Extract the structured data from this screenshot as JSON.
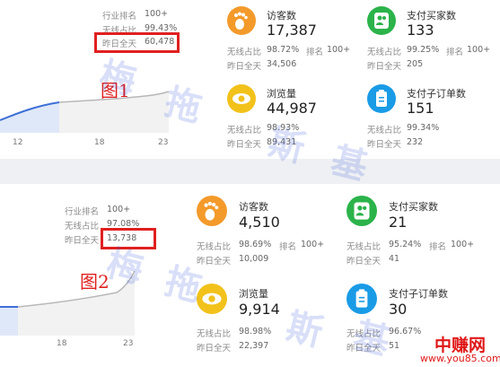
{
  "panel1": {
    "left_stats": {
      "industry_rank_label": "行业排名",
      "industry_rank_value": "100+",
      "wireless_label": "无线占比",
      "wireless_value": "99.43%",
      "yesterday_label": "昨日全天",
      "yesterday_value": "60,478"
    },
    "figure_label": "图1",
    "x_ticks": [
      "12",
      "18",
      "23"
    ],
    "cards": {
      "visitors": {
        "title": "访客数",
        "value": "17,387",
        "wireless_label": "无线占比",
        "wireless_value": "98.72%",
        "rank_label": "排名",
        "rank_value": "100+",
        "yesterday_label": "昨日全天",
        "yesterday_value": "34,506"
      },
      "buyers": {
        "title": "支付买家数",
        "value": "133",
        "wireless_label": "无线占比",
        "wireless_value": "99.25%",
        "rank_label": "排名",
        "rank_value": "100+",
        "yesterday_label": "昨日全天",
        "yesterday_value": "205"
      },
      "pageviews": {
        "title": "浏览量",
        "value": "44,987",
        "wireless_label": "无线占比",
        "wireless_value": "98.93%",
        "yesterday_label": "昨日全天",
        "yesterday_value": "89,431"
      },
      "orders": {
        "title": "支付子订单数",
        "value": "151",
        "wireless_label": "无线占比",
        "wireless_value": "99.34%",
        "yesterday_label": "昨日全天",
        "yesterday_value": "232"
      }
    }
  },
  "panel2": {
    "left_stats": {
      "industry_rank_label": "行业排名",
      "industry_rank_value": "100+",
      "wireless_label": "无线占比",
      "wireless_value": "97.08%",
      "yesterday_label": "昨日全天",
      "yesterday_value": "13,738"
    },
    "figure_label": "图2",
    "x_ticks": [
      "18",
      "23"
    ],
    "cards": {
      "visitors": {
        "title": "访客数",
        "value": "4,510",
        "wireless_label": "无线占比",
        "wireless_value": "98.69%",
        "rank_label": "排名",
        "rank_value": "100+",
        "yesterday_label": "昨日全天",
        "yesterday_value": "10,009"
      },
      "buyers": {
        "title": "支付买家数",
        "value": "21",
        "wireless_label": "无线占比",
        "wireless_value": "95.24%",
        "rank_label": "排名",
        "rank_value": "100+",
        "yesterday_label": "昨日全天",
        "yesterday_value": "41"
      },
      "pageviews": {
        "title": "浏览量",
        "value": "9,914",
        "wireless_label": "无线占比",
        "wireless_value": "98.98%",
        "yesterday_label": "昨日全天",
        "yesterday_value": "22,397"
      },
      "orders": {
        "title": "支付子订单数",
        "value": "30",
        "wireless_label": "无线占比",
        "wireless_value": "96.67%",
        "yesterday_label": "昨日全天",
        "yesterday_value": "51"
      }
    }
  },
  "watermark": {
    "chars": [
      "梅",
      "拖",
      "斯",
      "基"
    ]
  },
  "logo": {
    "main": "中赚网",
    "url": "www.you85.com"
  },
  "colors": {
    "orange": "#f39a2b",
    "green": "#2bb34a",
    "yellow": "#f2c21b",
    "blue": "#1a9be6",
    "red_box": "#e02020",
    "chart_line": "#3d6fd6"
  },
  "icons": {
    "visitors": "footprint-icon",
    "buyers": "users-icon",
    "pageviews": "eye-icon",
    "orders": "clipboard-icon"
  }
}
